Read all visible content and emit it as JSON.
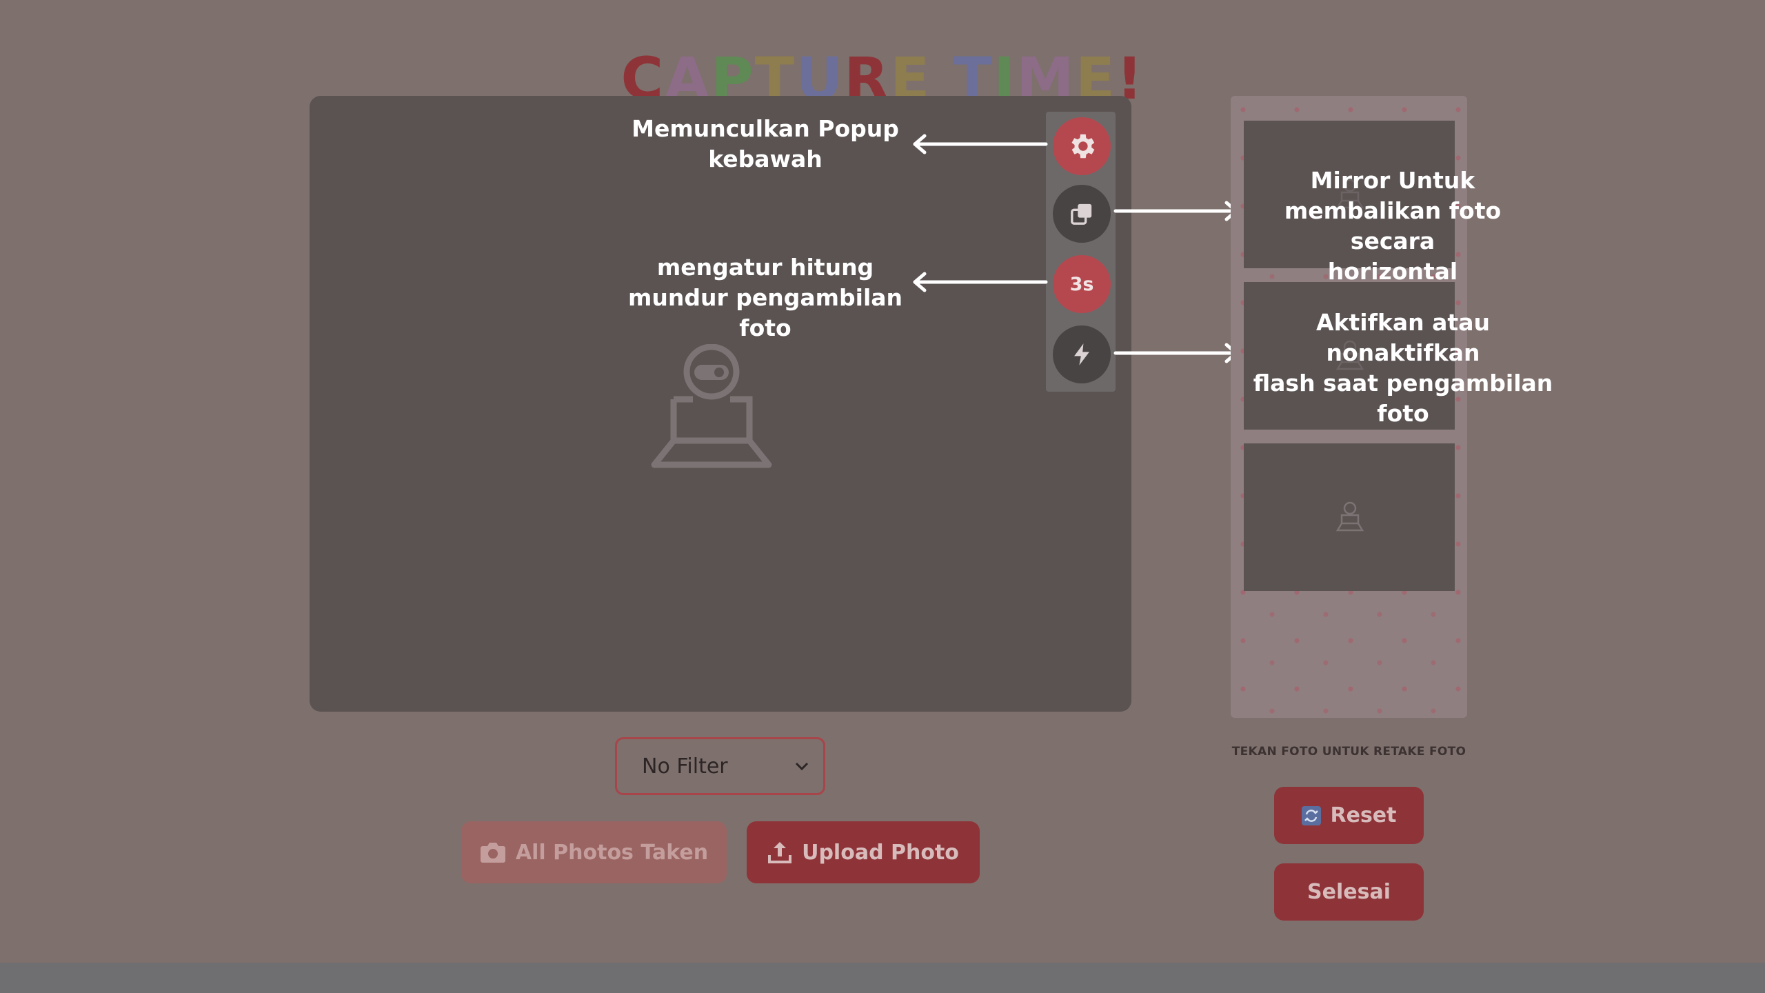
{
  "header": {
    "title_letters": [
      {
        "ch": "C",
        "color": "#8e3439"
      },
      {
        "ch": "A",
        "color": "#8c6c86"
      },
      {
        "ch": "P",
        "color": "#5f8a55"
      },
      {
        "ch": "T",
        "color": "#8e7d4e"
      },
      {
        "ch": "U",
        "color": "#6b6f9a"
      },
      {
        "ch": "R",
        "color": "#8e3439"
      },
      {
        "ch": "E",
        "color": "#8e7d4e"
      },
      {
        "ch": " ",
        "color": "#000000"
      },
      {
        "ch": "T",
        "color": "#6b6f9a"
      },
      {
        "ch": "I",
        "color": "#5f8a55"
      },
      {
        "ch": "M",
        "color": "#8c6c86"
      },
      {
        "ch": "E",
        "color": "#8e7d4e"
      },
      {
        "ch": "!",
        "color": "#8e3439"
      }
    ]
  },
  "camera": {
    "controls": {
      "settings_icon": "gear-icon",
      "mirror_icon": "mirror-copy-icon",
      "timer_label": "3s",
      "flash_icon": "lightning-icon"
    }
  },
  "annotations": {
    "settings": [
      "Memunculkan Popup",
      "kebawah"
    ],
    "timer": [
      "mengatur hitung",
      "mundur pengambilan",
      "foto"
    ],
    "mirror": [
      "Mirror Untuk",
      "membalikan foto secara",
      "horizontal"
    ],
    "flash": [
      "Aktifkan atau nonaktifkan",
      "flash saat pengambilan",
      "foto"
    ]
  },
  "photo_strip": {
    "slots": 3,
    "hint": "TEKAN FOTO UNTUK RETAKE FOTO"
  },
  "filter": {
    "selected": "No Filter"
  },
  "actions": {
    "all_taken_label": "All Photos Taken",
    "upload_label": "Upload Photo",
    "reset_label": "Reset",
    "done_label": "Selesai"
  },
  "colors": {
    "accent": "#b5484f",
    "button_dark": "#8e3439",
    "panel": "#5a5352",
    "overlay_bg": "#7e706c"
  }
}
